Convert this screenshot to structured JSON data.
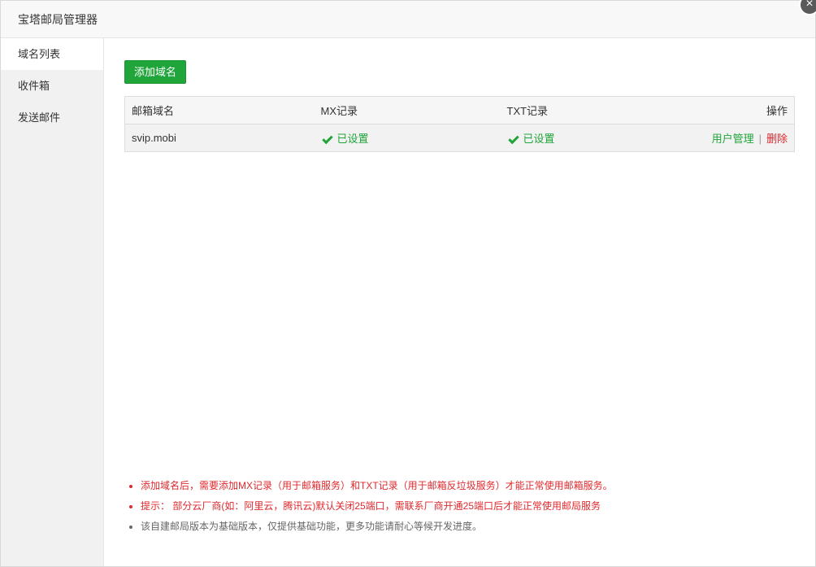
{
  "window": {
    "title": "宝塔邮局管理器",
    "close_label": "×"
  },
  "sidebar": {
    "items": [
      {
        "label": "域名列表",
        "active": true
      },
      {
        "label": "收件箱",
        "active": false
      },
      {
        "label": "发送邮件",
        "active": false
      }
    ]
  },
  "toolbar": {
    "add_domain_label": "添加域名"
  },
  "table": {
    "headers": [
      "邮箱域名",
      "MX记录",
      "TXT记录",
      "操作"
    ],
    "rows": [
      {
        "domain": "svip.mobi",
        "mx_status": "已设置",
        "txt_status": "已设置",
        "action_manage": "用户管理",
        "action_separator": "|",
        "action_delete": "删除"
      }
    ]
  },
  "notes": [
    "添加域名后，需要添加MX记录（用于邮箱服务）和TXT记录（用于邮箱反垃圾服务）才能正常使用邮箱服务。",
    "提示： 部分云厂商(如：阿里云，腾讯云)默认关闭25端口，需联系厂商开通25端口后才能正常使用邮局服务",
    "该自建邮局版本为基础版本，仅提供基础功能，更多功能请耐心等候开发进度。"
  ],
  "colors": {
    "accent_green": "#20a53a",
    "danger_red": "#e0292d"
  }
}
